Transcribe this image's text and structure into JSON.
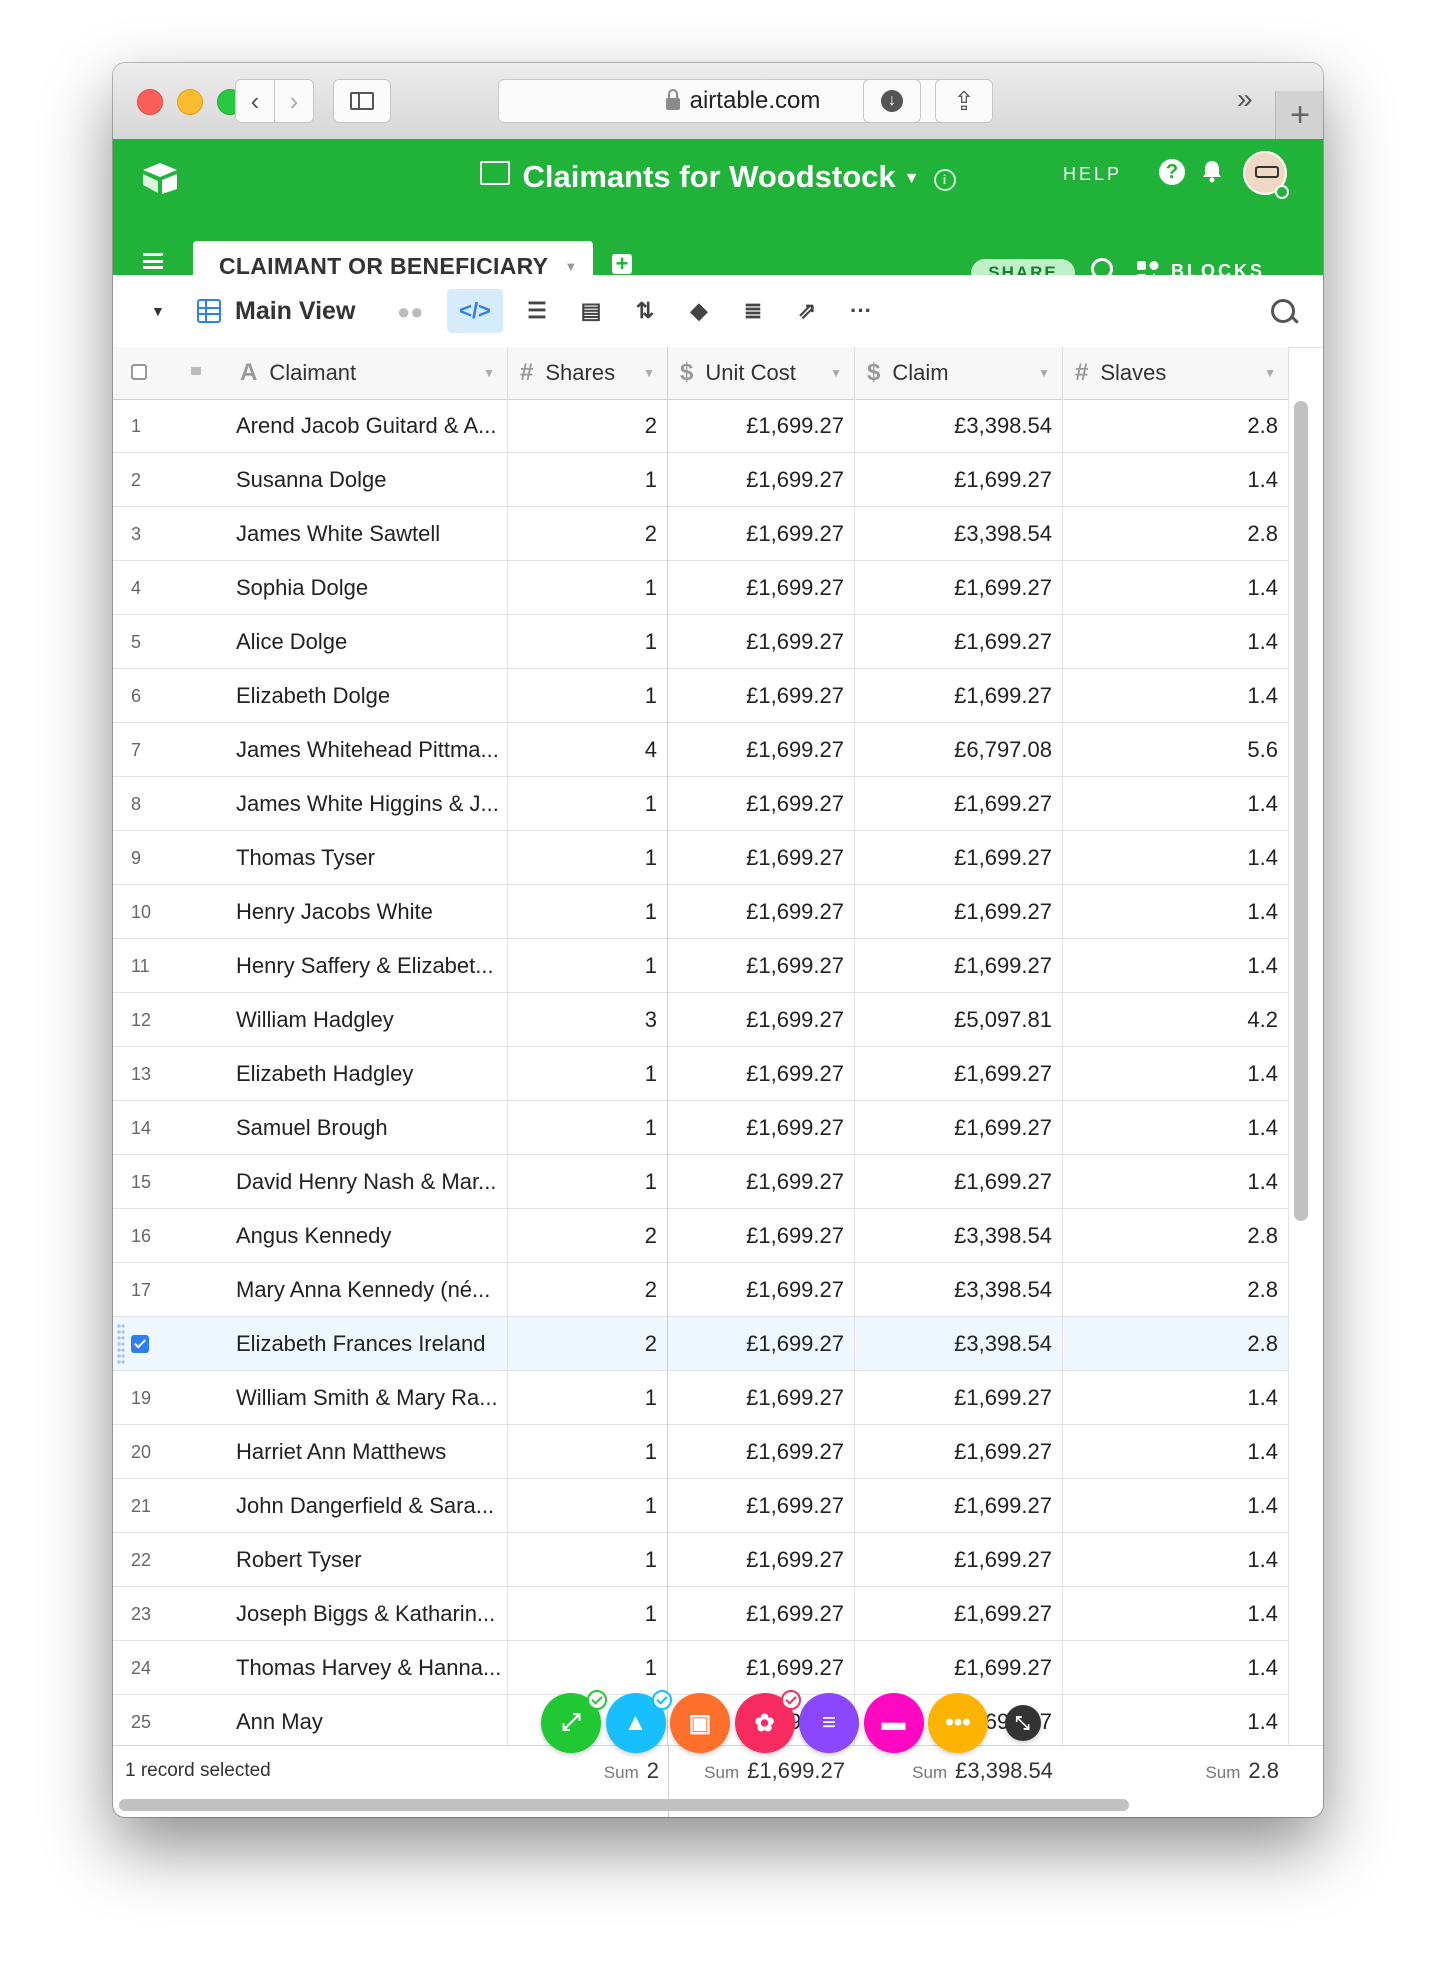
{
  "browser": {
    "url": "airtable.com",
    "new_tab_label": "+",
    "overflow_label": "»"
  },
  "base": {
    "title": "Claimants for Woodstock",
    "help_label": "HELP",
    "share_label": "SHARE",
    "blocks_label": "BLOCKS"
  },
  "table_tab": {
    "label": "CLAIMANT OR BENEFICIARY"
  },
  "view": {
    "name": "Main View"
  },
  "columns": [
    {
      "label": "Claimant",
      "type_icon": "text-type-icon",
      "glyph": "A"
    },
    {
      "label": "Shares",
      "type_icon": "number-type-icon",
      "glyph": "#"
    },
    {
      "label": "Unit Cost",
      "type_icon": "currency-type-icon",
      "glyph": "$"
    },
    {
      "label": "Claim",
      "type_icon": "currency-type-icon",
      "glyph": "$"
    },
    {
      "label": "Slaves",
      "type_icon": "number-type-icon",
      "glyph": "#"
    }
  ],
  "rows": [
    {
      "n": "1",
      "claimant": "Arend Jacob Guitard & A...",
      "shares": "2",
      "unit": "£1,699.27",
      "claim": "£3,398.54",
      "slaves": "2.8"
    },
    {
      "n": "2",
      "claimant": "Susanna Dolge",
      "shares": "1",
      "unit": "£1,699.27",
      "claim": "£1,699.27",
      "slaves": "1.4"
    },
    {
      "n": "3",
      "claimant": "James White Sawtell",
      "shares": "2",
      "unit": "£1,699.27",
      "claim": "£3,398.54",
      "slaves": "2.8"
    },
    {
      "n": "4",
      "claimant": "Sophia Dolge",
      "shares": "1",
      "unit": "£1,699.27",
      "claim": "£1,699.27",
      "slaves": "1.4"
    },
    {
      "n": "5",
      "claimant": "Alice Dolge",
      "shares": "1",
      "unit": "£1,699.27",
      "claim": "£1,699.27",
      "slaves": "1.4"
    },
    {
      "n": "6",
      "claimant": "Elizabeth Dolge",
      "shares": "1",
      "unit": "£1,699.27",
      "claim": "£1,699.27",
      "slaves": "1.4"
    },
    {
      "n": "7",
      "claimant": "James Whitehead Pittma...",
      "shares": "4",
      "unit": "£1,699.27",
      "claim": "£6,797.08",
      "slaves": "5.6"
    },
    {
      "n": "8",
      "claimant": "James White Higgins & J...",
      "shares": "1",
      "unit": "£1,699.27",
      "claim": "£1,699.27",
      "slaves": "1.4"
    },
    {
      "n": "9",
      "claimant": "Thomas Tyser",
      "shares": "1",
      "unit": "£1,699.27",
      "claim": "£1,699.27",
      "slaves": "1.4"
    },
    {
      "n": "10",
      "claimant": "Henry Jacobs White",
      "shares": "1",
      "unit": "£1,699.27",
      "claim": "£1,699.27",
      "slaves": "1.4"
    },
    {
      "n": "11",
      "claimant": "Henry Saffery & Elizabet...",
      "shares": "1",
      "unit": "£1,699.27",
      "claim": "£1,699.27",
      "slaves": "1.4"
    },
    {
      "n": "12",
      "claimant": "William Hadgley",
      "shares": "3",
      "unit": "£1,699.27",
      "claim": "£5,097.81",
      "slaves": "4.2"
    },
    {
      "n": "13",
      "claimant": "Elizabeth Hadgley",
      "shares": "1",
      "unit": "£1,699.27",
      "claim": "£1,699.27",
      "slaves": "1.4"
    },
    {
      "n": "14",
      "claimant": "Samuel Brough",
      "shares": "1",
      "unit": "£1,699.27",
      "claim": "£1,699.27",
      "slaves": "1.4"
    },
    {
      "n": "15",
      "claimant": "David Henry Nash & Mar...",
      "shares": "1",
      "unit": "£1,699.27",
      "claim": "£1,699.27",
      "slaves": "1.4"
    },
    {
      "n": "16",
      "claimant": "Angus Kennedy",
      "shares": "2",
      "unit": "£1,699.27",
      "claim": "£3,398.54",
      "slaves": "2.8"
    },
    {
      "n": "17",
      "claimant": "Mary Anna Kennedy (né...",
      "shares": "2",
      "unit": "£1,699.27",
      "claim": "£3,398.54",
      "slaves": "2.8"
    },
    {
      "n": "",
      "claimant": "Elizabeth Frances Ireland",
      "shares": "2",
      "unit": "£1,699.27",
      "claim": "£3,398.54",
      "slaves": "2.8",
      "selected": true
    },
    {
      "n": "19",
      "claimant": "William Smith & Mary Ra...",
      "shares": "1",
      "unit": "£1,699.27",
      "claim": "£1,699.27",
      "slaves": "1.4"
    },
    {
      "n": "20",
      "claimant": "Harriet Ann Matthews",
      "shares": "1",
      "unit": "£1,699.27",
      "claim": "£1,699.27",
      "slaves": "1.4"
    },
    {
      "n": "21",
      "claimant": "John Dangerfield & Sara...",
      "shares": "1",
      "unit": "£1,699.27",
      "claim": "£1,699.27",
      "slaves": "1.4"
    },
    {
      "n": "22",
      "claimant": "Robert Tyser",
      "shares": "1",
      "unit": "£1,699.27",
      "claim": "£1,699.27",
      "slaves": "1.4"
    },
    {
      "n": "23",
      "claimant": "Joseph Biggs & Katharin...",
      "shares": "1",
      "unit": "£1,699.27",
      "claim": "£1,699.27",
      "slaves": "1.4"
    },
    {
      "n": "24",
      "claimant": "Thomas Harvey & Hanna...",
      "shares": "1",
      "unit": "£1,699.27",
      "claim": "£1,699.27",
      "slaves": "1.4"
    },
    {
      "n": "25",
      "claimant": "Ann May",
      "shares": "1",
      "unit": "£1,699.27",
      "claim": "£1,699.27",
      "slaves": "1.4"
    }
  ],
  "footer": {
    "selection": "1 record selected",
    "sum_key": "Sum",
    "shares_sum": "2",
    "unit_sum": "£1,699.27",
    "claim_sum": "£3,398.54",
    "slaves_sum": "2.8"
  },
  "dock": [
    {
      "icon": "expand-arrows-icon",
      "color": "#20c933",
      "glyph": "⤢",
      "checked": true
    },
    {
      "icon": "shapes-icon",
      "color": "#18bfff",
      "glyph": "▲",
      "checked": true
    },
    {
      "icon": "image-icon",
      "color": "#ff6f2c",
      "glyph": "▣",
      "checked": false
    },
    {
      "icon": "apps-icon",
      "color": "#f82b60",
      "glyph": "✿",
      "checked": true
    },
    {
      "icon": "list-icon",
      "color": "#8b46ff",
      "glyph": "≡",
      "checked": false
    },
    {
      "icon": "comment-icon",
      "color": "#ff08c2",
      "glyph": "▬",
      "checked": false
    },
    {
      "icon": "more-icon",
      "color": "#fcb400",
      "glyph": "•••",
      "checked": false
    },
    {
      "icon": "collapse-arrows-icon",
      "color": "#333333",
      "glyph": "⤡",
      "checked": false
    }
  ],
  "colors": {
    "brand_green": "#20b239",
    "accent_blue": "#2d7ff9",
    "selected_row": "#eef6fe"
  }
}
